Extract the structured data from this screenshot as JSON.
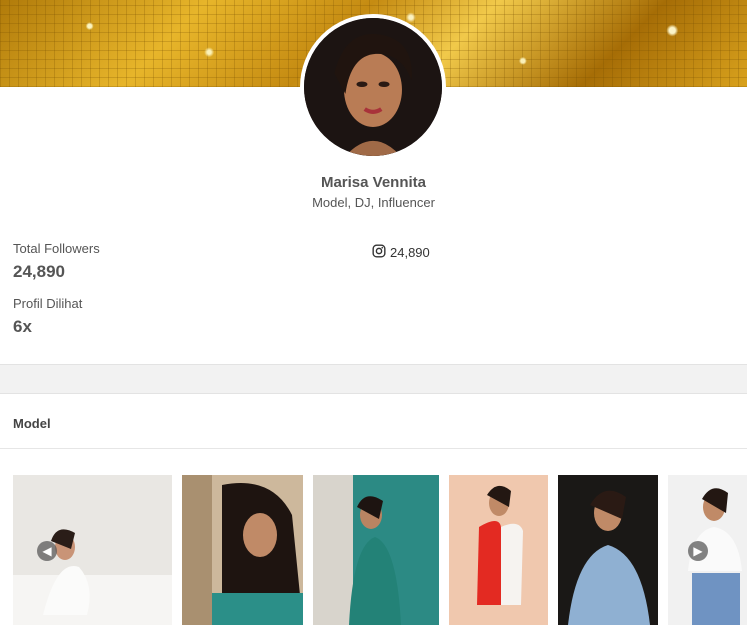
{
  "profile": {
    "name": "Marisa Vennita",
    "roles": "Model, DJ, Influencer"
  },
  "stats": {
    "followers_label": "Total Followers",
    "followers_value": "24,890",
    "views_label": "Profil Dilihat",
    "views_value": "6x"
  },
  "instagram": {
    "icon": "instagram-icon",
    "count": "24,890"
  },
  "section": {
    "title": "Model"
  },
  "gallery": {
    "prev_icon": "arrow-left-icon",
    "next_icon": "arrow-right-icon"
  },
  "colors": {
    "banner_gold": "#d9a21d",
    "text": "#555555",
    "band": "#f2f2f2"
  }
}
